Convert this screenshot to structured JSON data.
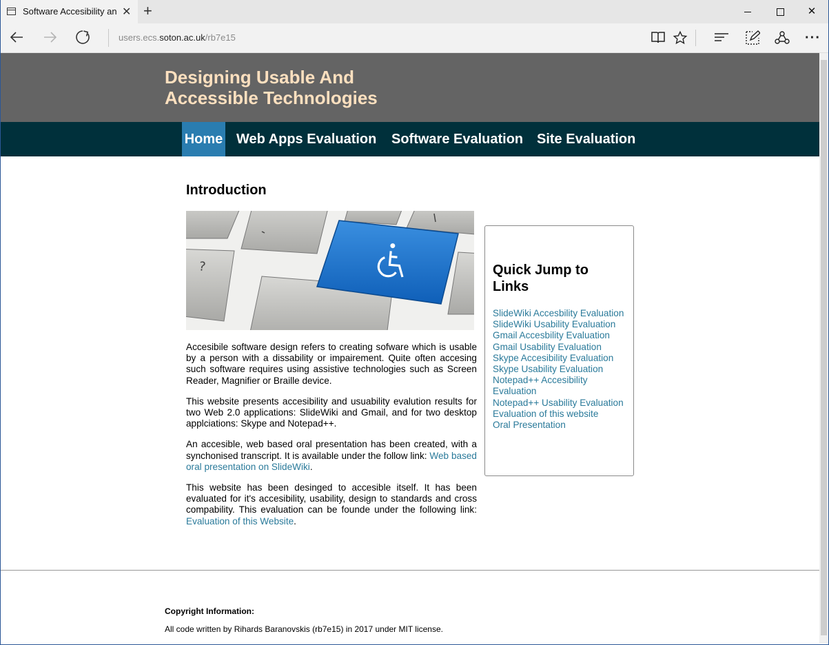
{
  "browser": {
    "tab_title": "Software Accesibility an",
    "tab_close": "✕",
    "new_tab": "+",
    "url_prefix": "users.ecs.",
    "url_host": "soton.ac.uk",
    "url_path": "/rb7e15",
    "more_icon": "···"
  },
  "site": {
    "title_line1": "Designing Usable And",
    "title_line2": "Accessible Technologies",
    "header_bg": "#646464",
    "title_color": "#fde0bf",
    "nav_bg": "#00303b",
    "nav_active_bg": "#2a7db0",
    "link_color": "#2a7a9a",
    "nav": [
      {
        "label": "Home",
        "active": true
      },
      {
        "label": "Web Apps Evaluation",
        "active": false
      },
      {
        "label": "Software Evaluation",
        "active": false
      },
      {
        "label": "Site Evaluation",
        "active": false
      }
    ]
  },
  "main": {
    "heading": "Introduction",
    "hero_image_icon": "wheelchair-accessibility-key",
    "p1": "Accesibile software design refers to creating sofware which is usable by a person with a dissability or impairement. Quite often accesing such software requires using assistive technologies such as Screen Reader, Magnifier or Braille device.",
    "p2": "This website presents accesibility and usuability evalution results for two Web 2.0 applications: SlideWiki and Gmail, and for two desktop applciations: Skype and Notepad++.",
    "p3_text": "An accesible, web based oral presentation has been created, with a synchonised transcript. It is available under the follow link: ",
    "p3_link": "Web based oral presentation on SlideWiki",
    "p3_end": ".",
    "p4_text": "This website has been desinged to accesible itself. It has been evaluated for it's accesibility, usability, design to standards and cross compability. This evaluation can be founde under the following link: ",
    "p4_link": "Evaluation of this Website",
    "p4_end": "."
  },
  "quick_links": {
    "title": "Quick Jump to Links",
    "items": [
      "SlideWiki Accesbility Evaluation",
      "SlideWiki Usability Evaluation",
      "Gmail Accesbility Evaluation",
      "Gmail Usability Evaluation",
      "Skype Accesibility Evaluation",
      "Skype Usability Evaluation",
      "Notepad++ Accesibility Evaluation",
      "Notepad++ Usability Evaluation",
      "Evaluation of this website",
      "Oral Presentation"
    ]
  },
  "footer": {
    "title": "Copyright Information:",
    "text": "All code written by Rihards Baranovskis (rb7e15) in 2017 under MIT license."
  }
}
